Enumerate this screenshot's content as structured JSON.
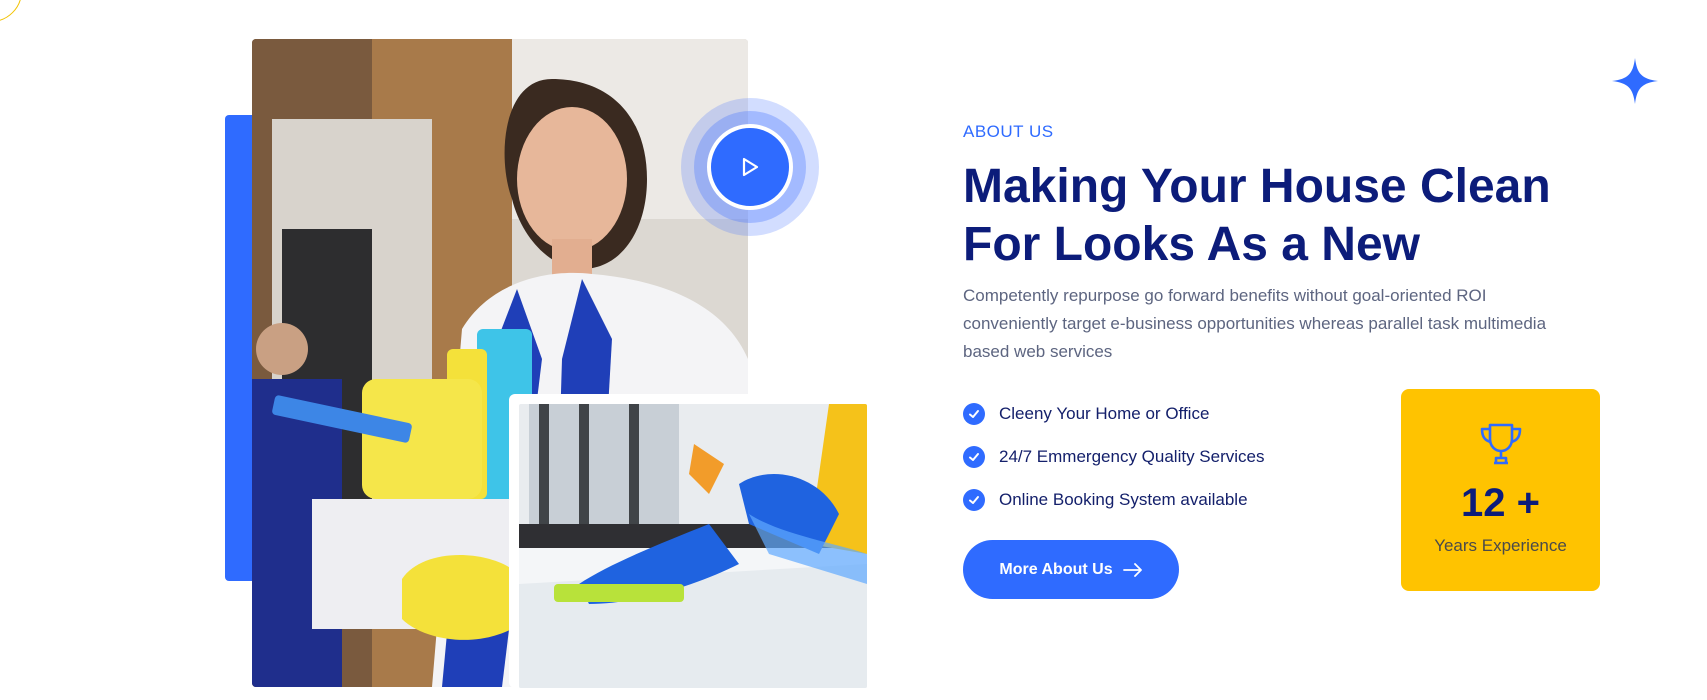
{
  "about": {
    "label": "ABOUT US",
    "headline": "Making Your House Clean For Looks As a New",
    "description": "Competently repurpose go forward benefits without goal-oriented ROI conveniently target e-business opportunities whereas parallel task multimedia based web services"
  },
  "features": [
    {
      "label": "Cleeny Your Home or Office",
      "icon": "check-circle-icon"
    },
    {
      "label": "24/7 Emmergency Quality Services",
      "icon": "check-circle-icon"
    },
    {
      "label": "Online Booking System available",
      "icon": "check-circle-icon"
    }
  ],
  "cta": {
    "label": "More About Us",
    "icon": "arrow-right-icon"
  },
  "experience": {
    "number": "12 +",
    "label": "Years Experience",
    "icon": "trophy-icon"
  },
  "media": {
    "play_icon": "play-icon"
  },
  "colors": {
    "primary": "#2f6bff",
    "heading": "#0c1c7a",
    "accent_yellow": "#ffc300",
    "body_text": "#5d6580"
  }
}
